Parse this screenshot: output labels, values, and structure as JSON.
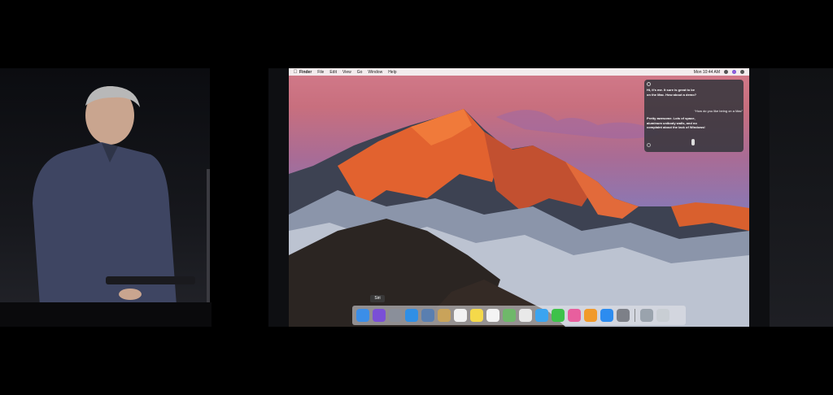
{
  "menubar": {
    "app_name": "Finder",
    "menus": [
      "File",
      "Edit",
      "View",
      "Go",
      "Window",
      "Help"
    ],
    "clock": "Mon 10:44 AM"
  },
  "siri": {
    "greeting": "Hi, it's me. It sure is great to be on the Mac. How about a demo?",
    "user_question": "“How do you like being on a Mac”",
    "answer": "Pretty awesome. Lots of space, aluminum unibody walls, and no complaint about the lack of Windows!"
  },
  "dock": {
    "tooltip": "Siri",
    "apps": [
      {
        "name": "finder-icon",
        "color": "#3b8ee8"
      },
      {
        "name": "siri-icon",
        "color": "#7a4fd6"
      },
      {
        "name": "launchpad-icon",
        "color": "#8a8f9a"
      },
      {
        "name": "safari-icon",
        "color": "#2f8fe6"
      },
      {
        "name": "photo-booth-icon",
        "color": "#5a7fb0"
      },
      {
        "name": "contacts-icon",
        "color": "#c9a35a"
      },
      {
        "name": "calendar-icon",
        "color": "#f2f2f2"
      },
      {
        "name": "notes-icon",
        "color": "#f5d94a"
      },
      {
        "name": "reminders-icon",
        "color": "#f4f4f4"
      },
      {
        "name": "maps-icon",
        "color": "#6fb86a"
      },
      {
        "name": "photos-icon",
        "color": "#e9e9e9"
      },
      {
        "name": "messages-icon",
        "color": "#3ba4f0"
      },
      {
        "name": "facetime-icon",
        "color": "#3ec24a"
      },
      {
        "name": "itunes-icon",
        "color": "#e85f9e"
      },
      {
        "name": "ibooks-icon",
        "color": "#f19a2b"
      },
      {
        "name": "app-store-icon",
        "color": "#2c8cf0"
      },
      {
        "name": "system-preferences-icon",
        "color": "#7d8088"
      }
    ],
    "right_items": [
      {
        "name": "downloads-stack-icon",
        "color": "#9aa3ad"
      },
      {
        "name": "trash-icon",
        "color": "#c9ced4"
      }
    ]
  }
}
